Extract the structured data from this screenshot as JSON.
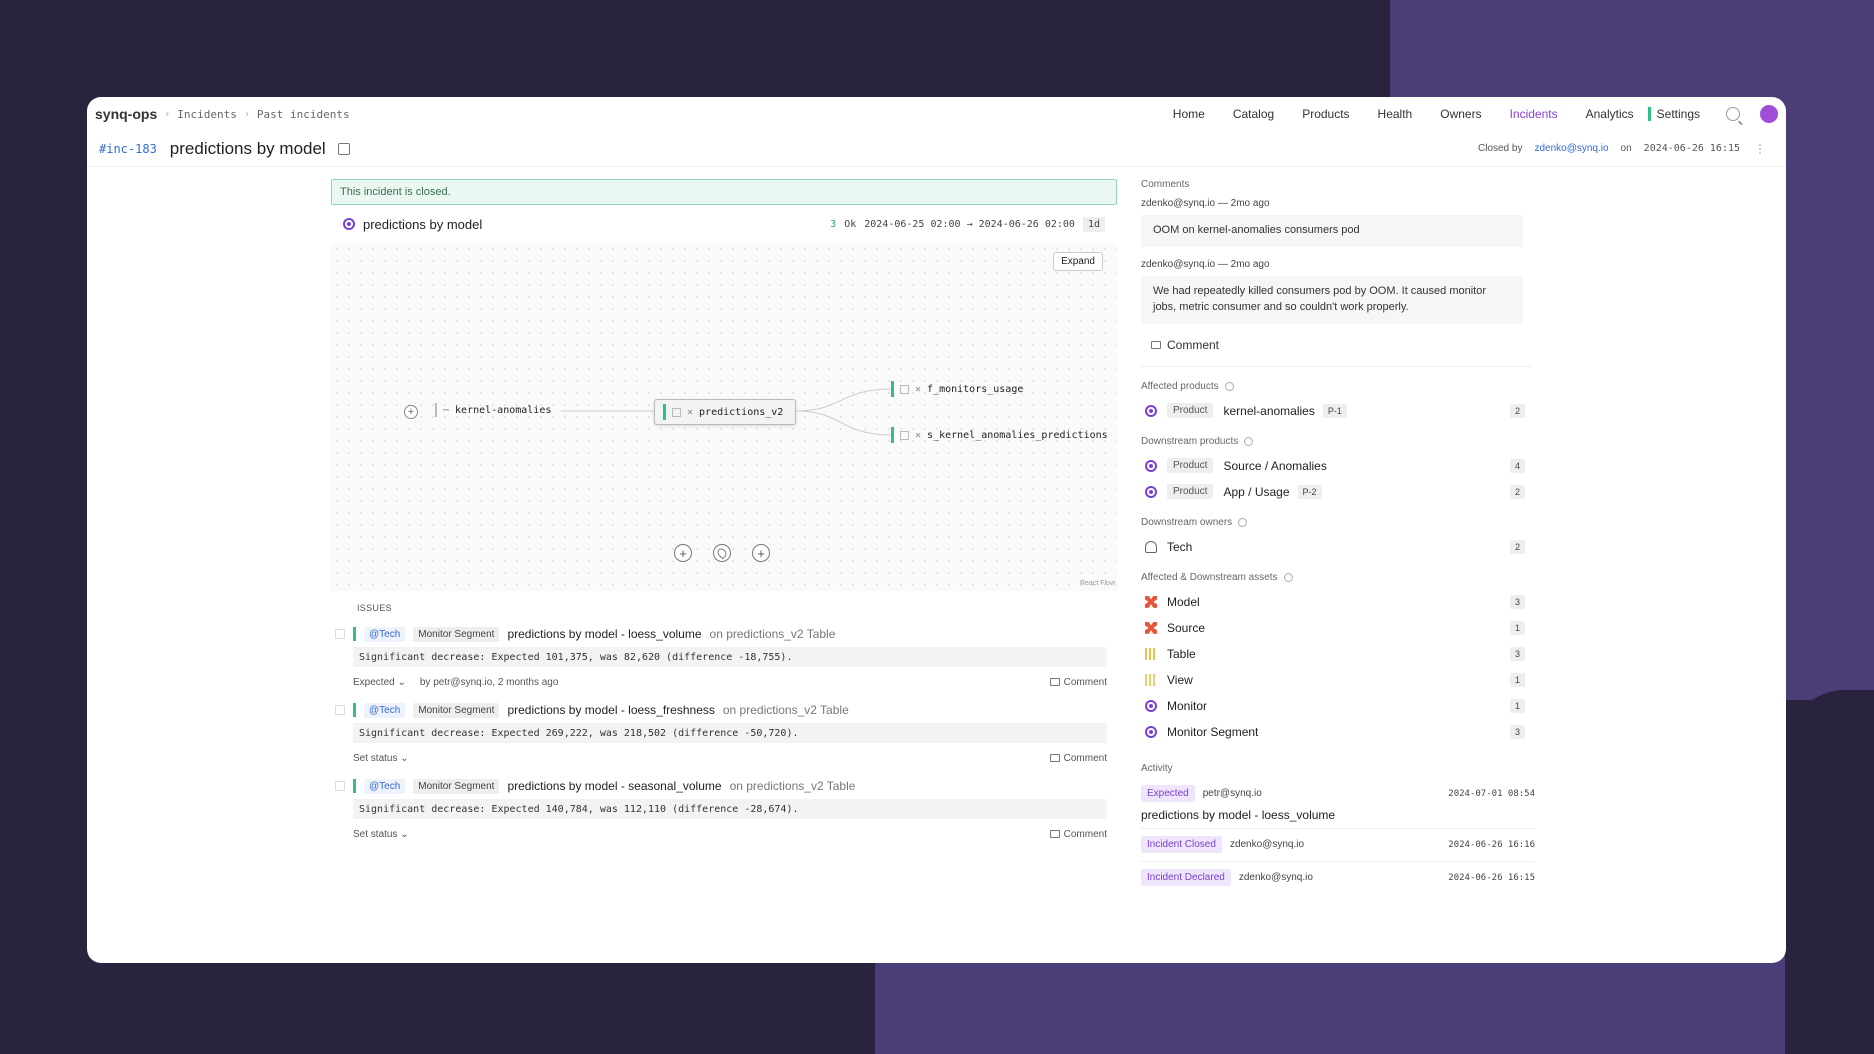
{
  "header": {
    "org": "synq-ops",
    "crumbs": [
      "Incidents",
      "Past incidents"
    ],
    "nav": [
      "Home",
      "Catalog",
      "Products",
      "Health",
      "Owners",
      "Incidents",
      "Analytics"
    ],
    "settings": "Settings",
    "active_nav": "Incidents"
  },
  "title": {
    "id": "#inc-183",
    "name": "predictions by model",
    "closed_by_label": "Closed by",
    "closed_by_user": "zdenko@synq.io",
    "on_label": "on",
    "closed_at": "2024-06-26 16:15"
  },
  "main": {
    "banner": "This incident is closed.",
    "incident_name": "predictions by model",
    "ok_count": "3",
    "ok_label": "Ok",
    "range": "2024-06-25 02:00 → 2024-06-26 02:00",
    "duration": "1d",
    "expand": "Expand",
    "react_flow": "React Flow",
    "nodes": {
      "upstream": "kernel-anomalies",
      "center": "predictions_v2",
      "down1": "f_monitors_usage",
      "down2": "s_kernel_anomalies_predictions"
    },
    "issues_label": "ISSUES",
    "issues": [
      {
        "owner": "@Tech",
        "kind": "Monitor Segment",
        "title": "predictions by model - loess_volume",
        "on": "on predictions_v2 Table",
        "detail": "Significant decrease: Expected 101,375, was 82,620 (difference -18,755).",
        "status": "Expected ⌄",
        "by": "by petr@synq.io, 2 months ago",
        "comment": "Comment"
      },
      {
        "owner": "@Tech",
        "kind": "Monitor Segment",
        "title": "predictions by model - loess_freshness",
        "on": "on predictions_v2 Table",
        "detail": "Significant decrease: Expected 269,222, was 218,502 (difference -50,720).",
        "status": "Set status ⌄",
        "by": "",
        "comment": "Comment"
      },
      {
        "owner": "@Tech",
        "kind": "Monitor Segment",
        "title": "predictions by model - seasonal_volume",
        "on": "on predictions_v2 Table",
        "detail": "Significant decrease: Expected 140,784, was 112,110 (difference -28,674).",
        "status": "Set status ⌄",
        "by": "",
        "comment": "Comment"
      }
    ]
  },
  "side": {
    "comments_title": "Comments",
    "comments": [
      {
        "author": "zdenko@synq.io — 2mo ago",
        "text": "OOM on kernel-anomalies consumers pod"
      },
      {
        "author": "zdenko@synq.io — 2mo ago",
        "text": "We had repeatedly killed consumers pod by OOM. It caused monitor jobs, metric consumer and so couldn't work properly."
      }
    ],
    "comment_action": "Comment",
    "affected_products_title": "Affected products",
    "affected_products": [
      {
        "label": "Product",
        "name": "kernel-anomalies",
        "prio": "P-1",
        "count": "2"
      }
    ],
    "downstream_products_title": "Downstream products",
    "downstream_products": [
      {
        "label": "Product",
        "name": "Source / Anomalies",
        "prio": "",
        "count": "4"
      },
      {
        "label": "Product",
        "name": "App / Usage",
        "prio": "P-2",
        "count": "2"
      }
    ],
    "downstream_owners_title": "Downstream owners",
    "downstream_owners": [
      {
        "name": "Tech",
        "count": "2"
      }
    ],
    "assets_title": "Affected & Downstream assets",
    "assets": [
      {
        "name": "Model",
        "icon": "model-icon",
        "count": "3"
      },
      {
        "name": "Source",
        "icon": "model-icon",
        "count": "1"
      },
      {
        "name": "Table",
        "icon": "table-icon",
        "count": "3"
      },
      {
        "name": "View",
        "icon": "view-icon",
        "count": "1"
      },
      {
        "name": "Monitor",
        "icon": "monitor-icon",
        "count": "1"
      },
      {
        "name": "Monitor Segment",
        "icon": "monitor-icon",
        "count": "3"
      }
    ],
    "activity_title": "Activity",
    "activity": [
      {
        "badge": "Expected",
        "user": "petr@synq.io",
        "ts": "2024-07-01 08:54",
        "desc": "predictions by model - loess_volume"
      },
      {
        "badge": "Incident Closed",
        "user": "zdenko@synq.io",
        "ts": "2024-06-26 16:16",
        "desc": ""
      },
      {
        "badge": "Incident Declared",
        "user": "zdenko@synq.io",
        "ts": "2024-06-26 16:15",
        "desc": ""
      }
    ]
  },
  "colors": {
    "accent": "#8b3dd9",
    "ok": "#2fbf8a",
    "link": "#2f6bd6",
    "background": "#2a2340",
    "background_shape": "#4a3d78"
  }
}
